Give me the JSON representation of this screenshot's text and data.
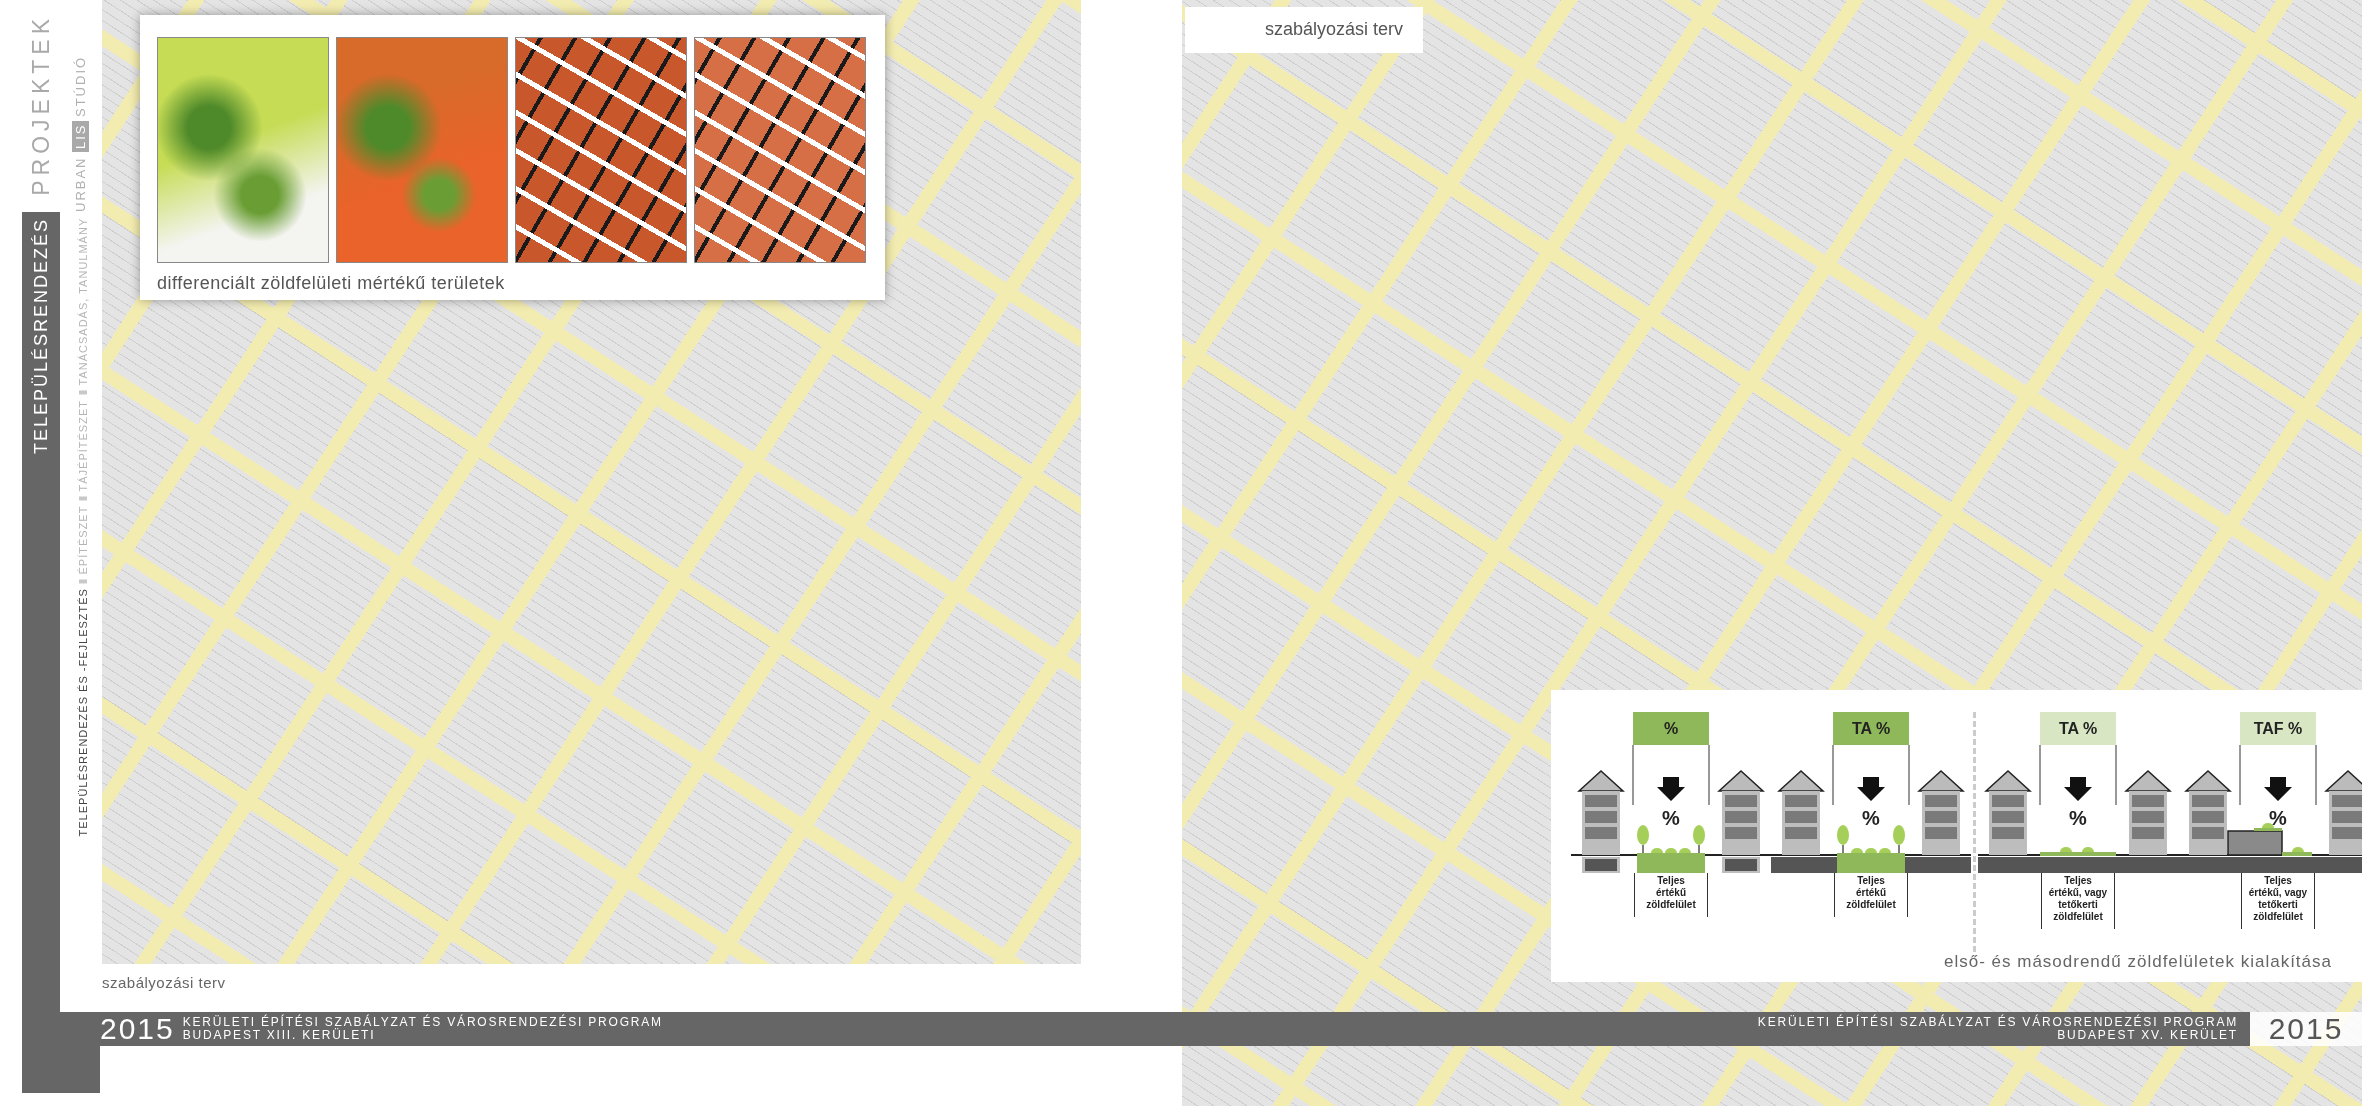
{
  "sidebar": {
    "section_title": "TELEPÜLÉSRENDEZÉS",
    "brand_title": "PROJEKTEK",
    "brand": {
      "prefix": "URBAN",
      "mark": "LIS",
      "suffix": "STÚDIÓ"
    },
    "services": [
      {
        "label": "TELEPÜLÉSRENDEZÉS ÉS -FEJLESZTÉS",
        "current": true
      },
      {
        "label": "ÉPÍTÉSZET",
        "current": false
      },
      {
        "label": "TÁJÉPÍTÉSZET",
        "current": false
      },
      {
        "label": "TANÁCSADÁS, TANULMÁNY",
        "current": false
      }
    ]
  },
  "left_page": {
    "inset_caption": "differenciált zöldfelületi mértékű területek",
    "map_caption": "szabályozási terv"
  },
  "right_page": {
    "map_caption": "szabályozási terv",
    "diagram": {
      "panels": [
        {
          "kind": "ground",
          "header": "%",
          "color": "#8fb85a",
          "symbol": "%",
          "label": "Teljes értékű zöldfelület"
        },
        {
          "kind": "podium-trees",
          "header": "TA %",
          "color": "#8fb85a",
          "symbol": "%",
          "label": "Teljes értékű zöldfelület"
        },
        {
          "kind": "podium",
          "header": "TA %",
          "color": "#d8e6c4",
          "symbol": "%",
          "label": "Teljes értékű, vagy tetőkerti zöldfelület"
        },
        {
          "kind": "stepped",
          "header": "TAF %",
          "color": "#d8e6c4",
          "symbol": "%",
          "label": "Teljes értékű, vagy tetőkerti zöldfelület"
        }
      ],
      "caption": "első- és másodrendű zöldfelületek kialakítása"
    }
  },
  "footer": {
    "left": {
      "year": "2015",
      "lines": [
        "KERÜLETI ÉPÍTÉSI SZABÁLYZAT ÉS VÁROSRENDEZÉSI PROGRAM",
        "BUDAPEST XIII. KERÜLETI"
      ]
    },
    "right": {
      "year": "2015",
      "lines": [
        "KERÜLETI ÉPÍTÉSI SZABÁLYZAT ÉS VÁROSRENDEZÉSI PROGRAM",
        "BUDAPEST XV. KERÜLET"
      ]
    }
  }
}
